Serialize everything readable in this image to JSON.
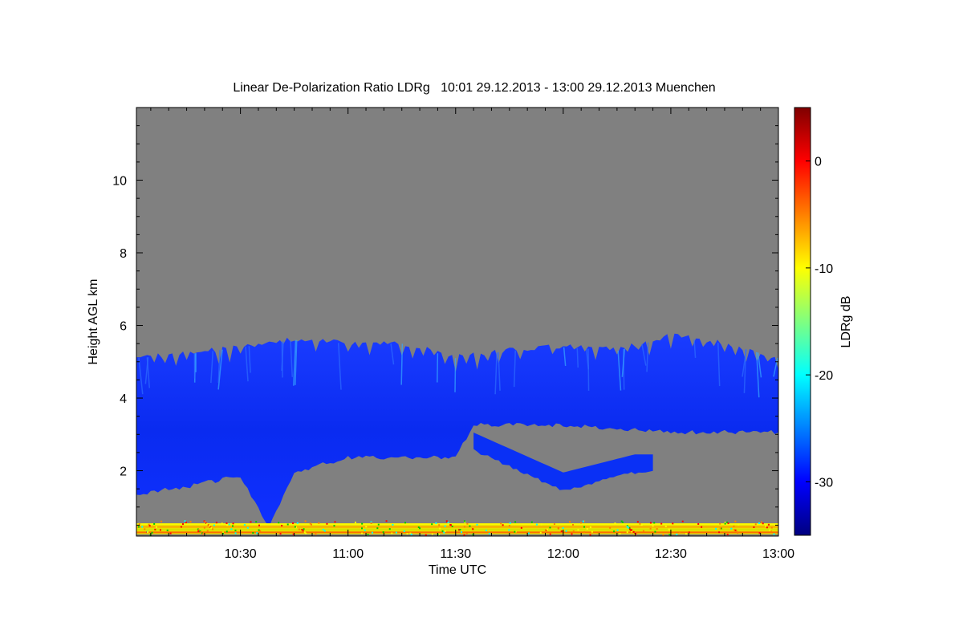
{
  "chart_data": {
    "type": "heatmap",
    "title": "Linear De-Polarization Ratio LDRg   10:01 29.12.2013 - 13:00 29.12.2013 Muenchen",
    "xlabel": "Time UTC",
    "ylabel": "Height AGL km",
    "colorbar_label": "LDRg dB",
    "x_ticks": [
      "10:30",
      "11:00",
      "11:30",
      "12:00",
      "12:30",
      "13:00"
    ],
    "x_tick_minutes": [
      30,
      60,
      90,
      120,
      150,
      180
    ],
    "xlim_minutes_after_10_00": [
      1,
      180
    ],
    "y_ticks": [
      2,
      4,
      6,
      8,
      10
    ],
    "ylim_km": [
      0.2,
      12.0
    ],
    "colorbar_ticks": [
      0,
      -10,
      -20,
      -30
    ],
    "colorbar_range_db": [
      -35,
      5
    ],
    "background_color": "#808080",
    "cloud_layer": {
      "description_values": "depolarization mostly near -30 dB",
      "top_km_at_time_minutes": [
        [
          1,
          5.2
        ],
        [
          15,
          5.3
        ],
        [
          30,
          5.5
        ],
        [
          45,
          5.7
        ],
        [
          60,
          5.6
        ],
        [
          75,
          5.6
        ],
        [
          90,
          5.2
        ],
        [
          105,
          5.4
        ],
        [
          120,
          5.5
        ],
        [
          135,
          5.4
        ],
        [
          150,
          5.8
        ],
        [
          165,
          5.6
        ],
        [
          180,
          5.2
        ]
      ],
      "base_km_at_time_minutes": [
        [
          1,
          1.3
        ],
        [
          15,
          1.5
        ],
        [
          30,
          1.8
        ],
        [
          38,
          0.4
        ],
        [
          45,
          1.9
        ],
        [
          60,
          2.3
        ],
        [
          75,
          2.3
        ],
        [
          90,
          2.3
        ],
        [
          95,
          3.2
        ],
        [
          120,
          3.2
        ],
        [
          150,
          3.0
        ],
        [
          180,
          3.0
        ]
      ],
      "lower_band_km": [
        [
          95,
          2.6
        ],
        [
          120,
          1.5
        ],
        [
          140,
          2.0
        ],
        [
          145,
          2.0
        ]
      ]
    },
    "surface_noise_band_km": [
      0.25,
      0.55
    ]
  }
}
